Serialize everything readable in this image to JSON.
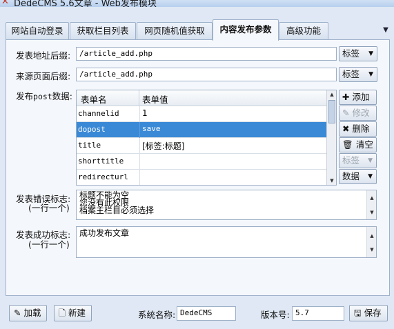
{
  "window": {
    "title": "DedeCMS 5.6文章 - Web发布模块"
  },
  "tabs": [
    {
      "label": "网站自动登录"
    },
    {
      "label": "获取栏目列表"
    },
    {
      "label": "网页随机值获取"
    },
    {
      "label": "内容发布参数",
      "active": true
    },
    {
      "label": "高级功能"
    }
  ],
  "form": {
    "post_suffix_label": "发表地址后缀:",
    "post_suffix_value": "/article_add.php",
    "source_suffix_label": "来源页面后缀:",
    "source_suffix_value": "/article_add.php",
    "tag_button": "标签",
    "post_data_label_prefix": "发布",
    "post_data_label_mono": "post",
    "post_data_label_suffix": "数据:"
  },
  "grid": {
    "headers": [
      "表单名",
      "表单值"
    ],
    "rows": [
      {
        "name": "channelid",
        "value": "1"
      },
      {
        "name": "dopost",
        "value": "save"
      },
      {
        "name": "title",
        "value": "[标签:标题]"
      },
      {
        "name": "shorttitle",
        "value": ""
      },
      {
        "name": "redirecturl",
        "value": ""
      }
    ],
    "selected_row": 1
  },
  "side_buttons": {
    "add": "添加",
    "edit": "修改",
    "delete": "删除",
    "clear": "清空",
    "tag": "标签",
    "data": "数据"
  },
  "error_flags": {
    "label_line1": "发表错误标志:",
    "label_line2": "(一行一个)",
    "lines": [
      "标题不能为空",
      "您没有此权限",
      "档案主栏目必须选择"
    ]
  },
  "success_flags": {
    "label_line1": "发表成功标志:",
    "label_line2": "(一行一个)",
    "lines": [
      "成功发布文章"
    ]
  },
  "bottom": {
    "load_button": "加载",
    "new_button": "新建",
    "system_name_label": "系统名称:",
    "system_name_value": "DedeCMS",
    "version_label": "版本号:",
    "version_value": "5.7",
    "save_button": "保存"
  }
}
